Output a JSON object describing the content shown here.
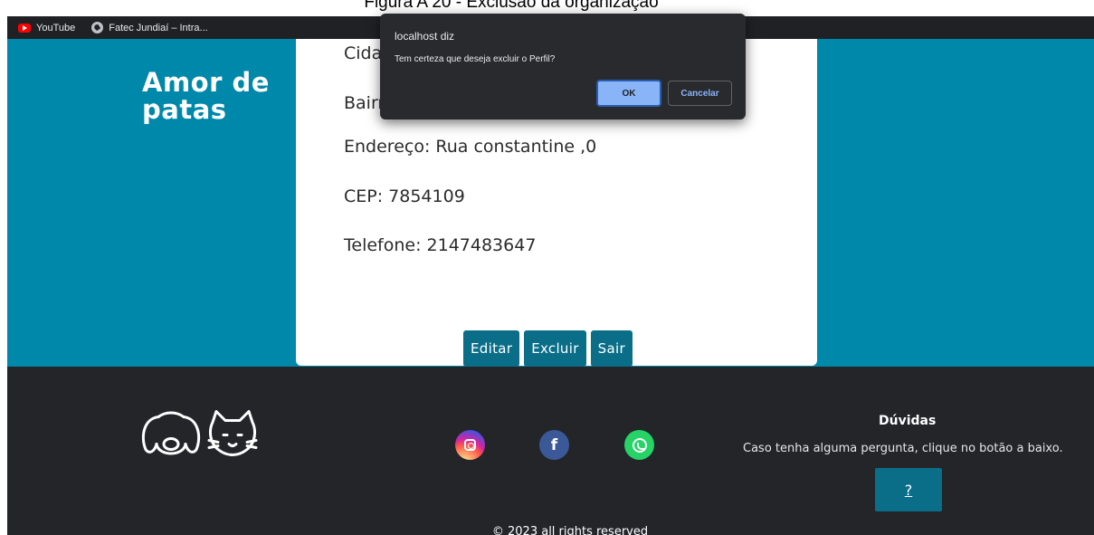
{
  "figure_caption": "Figura A 20 - Exclusão da organização",
  "bookmarks": [
    {
      "label": "YouTube",
      "icon": "youtube-icon"
    },
    {
      "label": "Fatec Jundiaí – Intra...",
      "icon": "globe-icon"
    }
  ],
  "profile": {
    "lines": [
      "Cidade:",
      "Bairro:",
      "Endereço: Rua constantine ,0",
      "CEP: 7854109",
      "Telefone: 2147483647"
    ],
    "actions": {
      "edit": "Editar",
      "delete": "Excluir",
      "exit": "Sair"
    }
  },
  "dialog": {
    "title": "localhost diz",
    "message": "Tem certeza que deseja excluir o Perfil?",
    "ok": "OK",
    "cancel": "Cancelar"
  },
  "footer": {
    "logo": {
      "line1": "Amor de",
      "line2": "patas"
    },
    "social": [
      "instagram-icon",
      "facebook-icon",
      "whatsapp-icon"
    ],
    "facebook_glyph": "f",
    "doubts": {
      "title": "Dúvidas",
      "text": "Caso tenha alguma pergunta, clique no botão a baixo.",
      "button": "?"
    },
    "copyright": "© 2023 all rights reserved"
  },
  "colors": {
    "page_teal": "#0088aa",
    "button_teal": "#0a6e89",
    "footer_dark": "#232529",
    "dialog_bg": "#292a2d",
    "dialog_ok": "#8ab4f8"
  }
}
